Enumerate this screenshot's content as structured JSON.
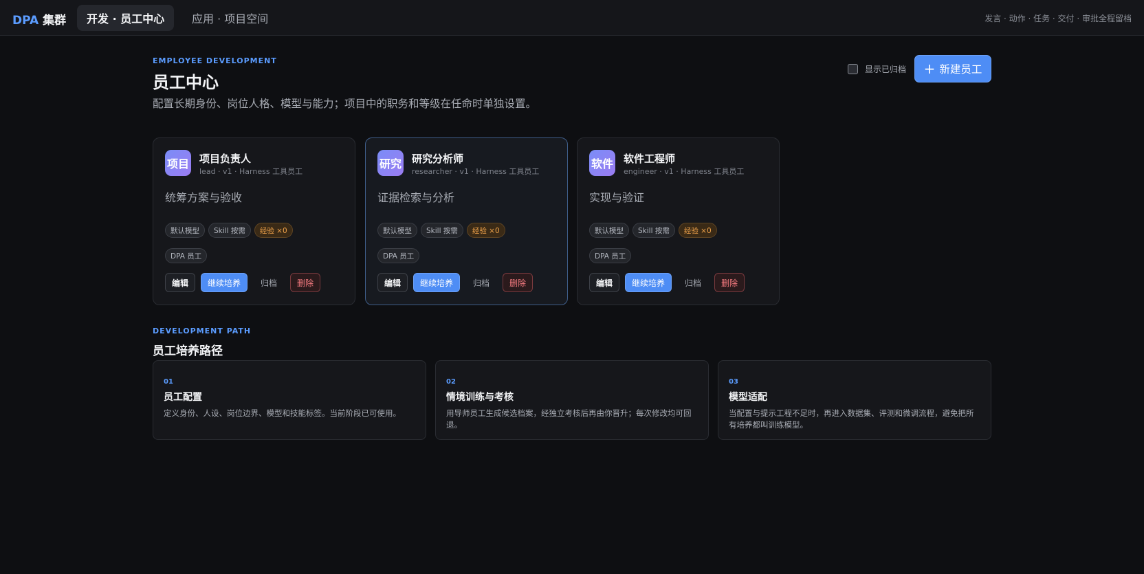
{
  "topbar": {
    "brand_prefix": "DPA",
    "brand_suffix": "集群",
    "active_tab": "开发 · 员工中心",
    "other_tab": "应用 · 项目空间",
    "right_links": "发言 · 动作 · 任务 · 交付 · 审批全程留档"
  },
  "header": {
    "eyebrow": "EMPLOYEE DEVELOPMENT",
    "title": "员工中心",
    "subtitle": "配置长期身份、岗位人格、模型与能力；项目中的职务和等级在任命时单独设置。",
    "show_archived_label": "显示已归档",
    "new_button_plus": "+",
    "new_button_label": "新建员工"
  },
  "cards": [
    {
      "avatar": "项目",
      "name": "项目负责人",
      "meta": "lead · v1 · Harness 工具员工",
      "desc": "统筹方案与验收",
      "tag_model": "默认模型",
      "tag_skill": "Skill 按需",
      "tag_exp": "经验 ×0",
      "tag_dpa": "DPA 员工",
      "edit": "编辑",
      "train": "继续培养",
      "archive": "归档",
      "delete": "删除"
    },
    {
      "avatar": "研究",
      "name": "研究分析师",
      "meta": "researcher · v1 · Harness 工具员工",
      "desc": "证据检索与分析",
      "tag_model": "默认模型",
      "tag_skill": "Skill 按需",
      "tag_exp": "经验 ×0",
      "tag_dpa": "DPA 员工",
      "edit": "编辑",
      "train": "继续培养",
      "archive": "归档",
      "delete": "删除"
    },
    {
      "avatar": "软件",
      "name": "软件工程师",
      "meta": "engineer · v1 · Harness 工具员工",
      "desc": "实现与验证",
      "tag_model": "默认模型",
      "tag_skill": "Skill 按需",
      "tag_exp": "经验 ×0",
      "tag_dpa": "DPA 员工",
      "edit": "编辑",
      "train": "继续培养",
      "archive": "归档",
      "delete": "删除"
    }
  ],
  "path": {
    "eyebrow": "DEVELOPMENT PATH",
    "title": "员工培养路径",
    "steps": [
      {
        "num": "01",
        "title": "员工配置",
        "desc": "定义身份、人设、岗位边界、模型和技能标签。当前阶段已可使用。"
      },
      {
        "num": "02",
        "title": "情境训练与考核",
        "desc": "用导师员工生成候选档案，经独立考核后再由你晋升；每次修改均可回退。"
      },
      {
        "num": "03",
        "title": "模型适配",
        "desc": "当配置与提示工程不足时，再进入数据集、评测和微调流程，避免把所有培养都叫训练模型。"
      }
    ]
  }
}
